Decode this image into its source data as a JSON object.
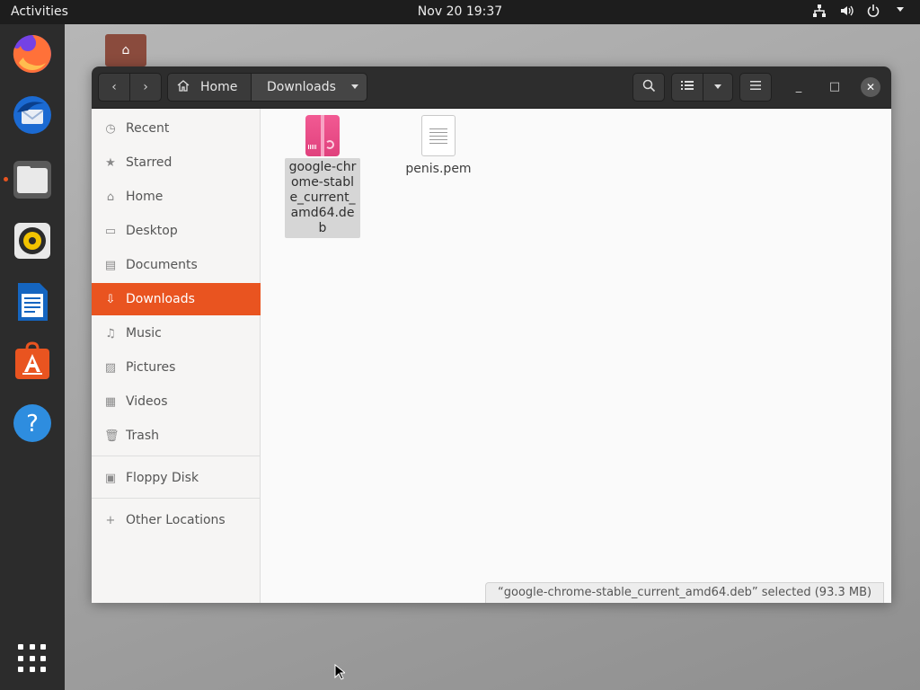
{
  "topbar": {
    "activities": "Activities",
    "clock": "Nov 20  19:37",
    "tray_icons": [
      "network-icon",
      "volume-icon",
      "power-icon",
      "chevron-down-icon"
    ]
  },
  "dock": {
    "apps": [
      "firefox",
      "thunderbird",
      "files",
      "rhythmbox",
      "libreoffice-writer",
      "ubuntu-software",
      "help"
    ],
    "show_apps": "app-grid-icon",
    "accent": "#e95420"
  },
  "window": {
    "breadcrumb": {
      "home": "Home",
      "downloads": "Downloads"
    },
    "sidebar": {
      "items": [
        {
          "label": "Recent",
          "icon": "clock-icon"
        },
        {
          "label": "Starred",
          "icon": "star-icon"
        },
        {
          "label": "Home",
          "icon": "home-icon"
        },
        {
          "label": "Desktop",
          "icon": "desktop-icon"
        },
        {
          "label": "Documents",
          "icon": "documents-icon"
        },
        {
          "label": "Downloads",
          "icon": "download-icon",
          "active": true
        },
        {
          "label": "Music",
          "icon": "music-icon"
        },
        {
          "label": "Pictures",
          "icon": "pictures-icon"
        },
        {
          "label": "Videos",
          "icon": "videos-icon"
        },
        {
          "label": "Trash",
          "icon": "trash-icon"
        }
      ],
      "devices": [
        {
          "label": "Floppy Disk",
          "icon": "floppy-icon"
        }
      ],
      "other": {
        "label": "Other Locations",
        "icon": "plus-icon"
      }
    },
    "files": [
      {
        "name": "google-chrome-stable_current_amd64.deb",
        "display": "google-chrome-stable_current_amd64.deb",
        "type": "deb",
        "selected": true
      },
      {
        "name": "penis.pem",
        "display": "penis.pem",
        "type": "text",
        "selected": false
      }
    ],
    "status": "“google-chrome-stable_current_amd64.deb” selected  (93.3 MB)"
  }
}
